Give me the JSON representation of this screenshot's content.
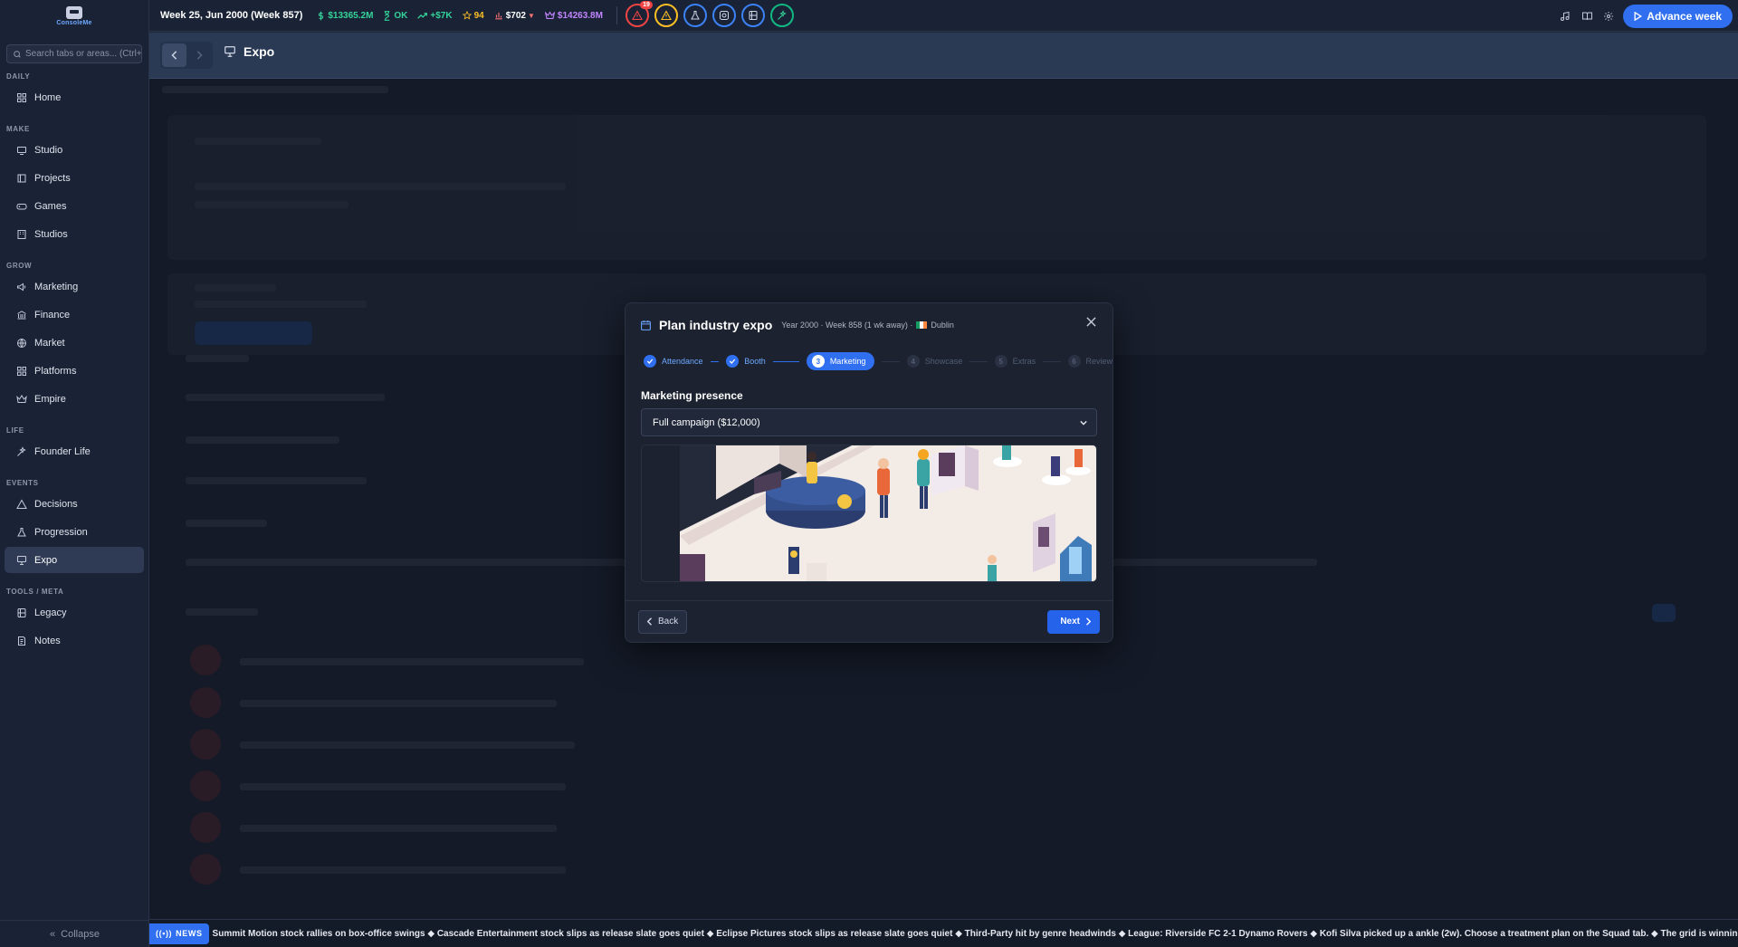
{
  "app": {
    "logo_text_a": "Console",
    "logo_text_b": "Me"
  },
  "search": {
    "placeholder": "Search tabs or areas... (Ctrl+K)"
  },
  "sidebar": {
    "sections": [
      {
        "label": "DAILY",
        "items": [
          {
            "label": "Home",
            "icon": "home-icon"
          }
        ]
      },
      {
        "label": "MAKE",
        "items": [
          {
            "label": "Studio",
            "icon": "studio-icon"
          },
          {
            "label": "Projects",
            "icon": "projects-icon"
          },
          {
            "label": "Games",
            "icon": "games-icon"
          },
          {
            "label": "Studios",
            "icon": "studios-icon"
          }
        ]
      },
      {
        "label": "GROW",
        "items": [
          {
            "label": "Marketing",
            "icon": "megaphone-icon"
          },
          {
            "label": "Finance",
            "icon": "bank-icon"
          },
          {
            "label": "Market",
            "icon": "globe-icon"
          },
          {
            "label": "Platforms",
            "icon": "grid-icon"
          },
          {
            "label": "Empire",
            "icon": "crown-icon"
          }
        ]
      },
      {
        "label": "LIFE",
        "items": [
          {
            "label": "Founder Life",
            "icon": "sparkle-icon"
          }
        ]
      },
      {
        "label": "EVENTS",
        "items": [
          {
            "label": "Decisions",
            "icon": "triangle-icon"
          },
          {
            "label": "Progression",
            "icon": "flask-icon"
          },
          {
            "label": "Expo",
            "icon": "presentation-icon",
            "active": true
          }
        ]
      },
      {
        "label": "TOOLS / META",
        "items": [
          {
            "label": "Legacy",
            "icon": "book-icon"
          },
          {
            "label": "Notes",
            "icon": "notes-icon"
          }
        ]
      }
    ],
    "collapse_label": "Collapse"
  },
  "topbar": {
    "week": "Week 25, Jun 2000 (Week 857)",
    "cash": "$13365.2M",
    "status": "OK",
    "trend": "+$7K",
    "rating": "94",
    "price": "$702",
    "empire_value": "$14263.8M",
    "alert_badge": "19",
    "advance_label": "Advance week",
    "colors": {
      "accent": "#2f6ff0",
      "green": "#34d399",
      "yellow": "#fbbf24",
      "purple": "#c084fc",
      "red": "#ef4444"
    }
  },
  "page": {
    "title": "Expo"
  },
  "modal": {
    "title": "Plan industry expo",
    "subtitle_prefix": "Year 2000 · Week 858 (1 wk away) ·",
    "city": "Dublin",
    "steps": [
      {
        "num": "1",
        "label": "Attendance",
        "state": "done"
      },
      {
        "num": "2",
        "label": "Booth",
        "state": "done"
      },
      {
        "num": "3",
        "label": "Marketing",
        "state": "current"
      },
      {
        "num": "4",
        "label": "Showcase",
        "state": "todo"
      },
      {
        "num": "5",
        "label": "Extras",
        "state": "todo"
      },
      {
        "num": "6",
        "label": "Review",
        "state": "todo"
      }
    ],
    "field_label": "Marketing presence",
    "selected_option": "Full campaign ($12,000)",
    "back_label": "Back",
    "next_label": "Next"
  },
  "news": {
    "tag": "NEWS",
    "text": "Summit Motion stock rallies on box-office swings ◆ Cascade Entertainment stock slips as release slate goes quiet ◆ Eclipse Pictures stock slips as release slate goes quiet ◆ Third-Party hit by genre headwinds ◆ League: Riverside FC 2-1 Dynamo Rovers ◆ Kofi Silva picked up a ankle (2w). Choose a treatment plan on the Squad tab. ◆ The grid is winning column inches — performance models are r"
  }
}
